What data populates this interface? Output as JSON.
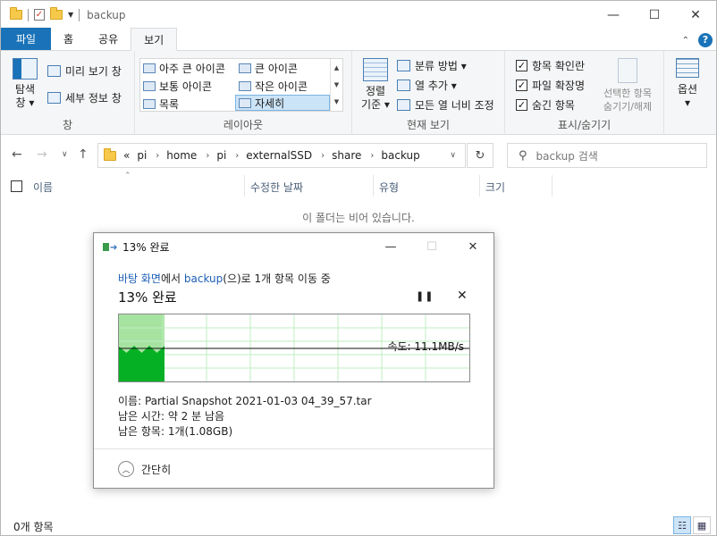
{
  "window": {
    "title": "backup",
    "controls": {
      "minimize": "—",
      "maximize": "☐",
      "close": "✕"
    }
  },
  "ribbon_tabs": [
    {
      "label": "파일"
    },
    {
      "label": "홈"
    },
    {
      "label": "공유"
    },
    {
      "label": "보기"
    }
  ],
  "ribbon": {
    "pane_group": {
      "navigation_pane": "탐색\n창 ▾",
      "preview_pane": "미리 보기 창",
      "details_pane": "세부 정보 창",
      "label": "창"
    },
    "layout_group": {
      "items": [
        "아주 큰 아이콘",
        "큰 아이콘",
        "보통 아이콘",
        "작은 아이콘",
        "목록",
        "자세히"
      ],
      "selected": "자세히",
      "label": "레이아웃"
    },
    "current_view_group": {
      "sort_by": "정렬\n기준 ▾",
      "group_by": "분류 방법 ▾",
      "add_columns": "열 추가 ▾",
      "fit_columns": "모든 열 너비 조정",
      "label": "현재 보기"
    },
    "show_hide_group": {
      "item_checkboxes": "항목 확인란",
      "file_extensions": "파일 확장명",
      "hidden_items": "숨긴 항목",
      "hide_selected": "선택한 항목\n숨기기/해제",
      "label": "표시/숨기기"
    },
    "options": "옵션\n▾"
  },
  "address_bar": {
    "prefix": "«",
    "path": [
      "pi",
      "home",
      "pi",
      "externalSSD",
      "share",
      "backup"
    ],
    "search_placeholder": "backup 검색"
  },
  "columns": [
    "이름",
    "수정한 날짜",
    "유형",
    "크기"
  ],
  "empty_message": "이 폴더는 비어 있습니다.",
  "status_bar": {
    "item_count": "0개 항목"
  },
  "progress_dialog": {
    "title": "13% 완료",
    "source_link": "바탕 화면",
    "text_mid": "에서 ",
    "dest_link": "backup",
    "text_end": "(으)로 1개 항목 이동 중",
    "percent_text": "13% 완료",
    "percent_value": 13,
    "speed": "속도: 11.1MB/s",
    "name_label": "이름: Partial Snapshot 2021-01-03 04_39_57.tar",
    "time_remaining": "남은 시간: 약 2 분 남음",
    "items_remaining": "남은 항목: 1개(1.08GB)",
    "collapse_label": "간단히",
    "colors": {
      "progress_fill": "#a6e3a1",
      "throughput": "#06b025",
      "grid": "#bfeec0",
      "speed_line": "#111111"
    }
  }
}
